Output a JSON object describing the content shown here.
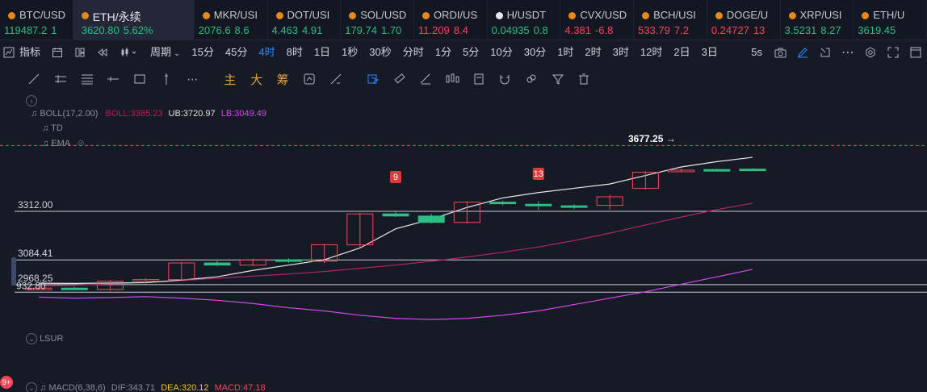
{
  "tickers": [
    {
      "symbol": "BTC/USD",
      "price": "119487.2",
      "change": "1",
      "dir": "up",
      "icon": "orange-dot-icon"
    },
    {
      "symbol": "ETH/永续",
      "price": "3620.80",
      "change": "5.62%",
      "dir": "up",
      "icon": "orange-dot-icon",
      "active": true
    },
    {
      "symbol": "MKR/USI",
      "price": "2076.6",
      "change": "8.6",
      "dir": "up",
      "icon": "orange-dot-icon"
    },
    {
      "symbol": "DOT/USI",
      "price": "4.463",
      "change": "4.91",
      "dir": "up",
      "icon": "orange-dot-icon"
    },
    {
      "symbol": "SOL/USD",
      "price": "179.74",
      "change": "1.70",
      "dir": "up",
      "icon": "orange-dot-icon"
    },
    {
      "symbol": "ORDI/US",
      "price": "11.209",
      "change": "8.4",
      "dir": "down",
      "icon": "orange-dot-icon"
    },
    {
      "symbol": "H/USDT",
      "price": "0.04935",
      "change": "0.8",
      "dir": "up",
      "icon": "white-dot-icon"
    },
    {
      "symbol": "CVX/USD",
      "price": "4.381",
      "change": "-6.8",
      "dir": "down",
      "icon": "orange-dot-icon"
    },
    {
      "symbol": "BCH/USI",
      "price": "533.79",
      "change": "7.2",
      "dir": "down",
      "icon": "orange-dot-icon"
    },
    {
      "symbol": "DOGE/U",
      "price": "0.24727",
      "change": "13",
      "dir": "down",
      "icon": "orange-dot-icon"
    },
    {
      "symbol": "XRP/USI",
      "price": "3.5231",
      "change": "8.27",
      "dir": "up",
      "icon": "orange-dot-icon"
    },
    {
      "symbol": "ETH/U",
      "price": "3619.45",
      "change": "",
      "dir": "up",
      "icon": "eth-icon"
    }
  ],
  "toolbar": {
    "indicators_label": "指标",
    "period_label": "周期",
    "intervals": [
      "15分",
      "45分",
      "4时",
      "8时",
      "1日",
      "1秒",
      "30秒",
      "分时",
      "1分",
      "5分",
      "10分",
      "30分",
      "1时",
      "2时",
      "3时",
      "12时",
      "2日",
      "3日"
    ],
    "selected_interval": "4时",
    "refresh_label": "5s"
  },
  "drawing_tools": {
    "main_label": "主",
    "big_label": "大",
    "chip_label": "筹"
  },
  "indicators": {
    "boll": {
      "label": "BOLL(17,2.00)",
      "mid": "BOLL:3385.23",
      "ub": "UB:3720.97",
      "lb": "LB:3049.49"
    },
    "td": "TD",
    "ema": "EMA",
    "lsur": "LSUR",
    "macd": {
      "label": "MACD(6,38,6)",
      "dif": "DIF:343.71",
      "dea": "DEA:320.12",
      "macd": "MACD:47.18"
    }
  },
  "price_labels": [
    "3312.00",
    "3084.41",
    "2968.25",
    "932.80"
  ],
  "annotations": {
    "high": "3677.25",
    "td_9": "9",
    "td_13": "13"
  },
  "notification_badge": "9+",
  "chart_data": {
    "type": "candlestick",
    "series": [
      {
        "name": "candles",
        "ohlc": [
          [
            2950,
            2955,
            2945,
            2952
          ],
          [
            2952,
            2958,
            2944,
            2946
          ],
          [
            2946,
            2990,
            2940,
            2985
          ],
          [
            2985,
            2998,
            2970,
            2992
          ],
          [
            2992,
            3075,
            2985,
            3070
          ],
          [
            3070,
            3080,
            3055,
            3060
          ],
          [
            3060,
            3090,
            3055,
            3085
          ],
          [
            3085,
            3092,
            3070,
            3078
          ],
          [
            3078,
            3160,
            3070,
            3155
          ],
          [
            3155,
            3305,
            3140,
            3300
          ],
          [
            3300,
            3310,
            3285,
            3290
          ],
          [
            3290,
            3300,
            3255,
            3260
          ],
          [
            3260,
            3360,
            3255,
            3355
          ],
          [
            3355,
            3362,
            3340,
            3348
          ],
          [
            3345,
            3360,
            3318,
            3338
          ],
          [
            3338,
            3345,
            3322,
            3332
          ],
          [
            3340,
            3390,
            3320,
            3380
          ],
          [
            3420,
            3500,
            3415,
            3495
          ],
          [
            3505,
            3512,
            3495,
            3505
          ],
          [
            3508,
            3512,
            3500,
            3506
          ],
          [
            3510,
            3514,
            3502,
            3506
          ]
        ]
      },
      {
        "name": "BOLL",
        "values": [
          2975,
          2974,
          2976,
          2978,
          2990,
          3005,
          3035,
          3060,
          3085,
          3140,
          3230,
          3275,
          3330,
          3375,
          3400,
          3420,
          3440,
          3480,
          3520,
          3545,
          3565
        ]
      },
      {
        "name": "UB",
        "values": [
          2962,
          2965,
          2972,
          2978,
          2988,
          2998,
          3008,
          3018,
          3030,
          3045,
          3060,
          3078,
          3098,
          3120,
          3145,
          3175,
          3210,
          3248,
          3285,
          3320,
          3350
        ]
      },
      {
        "name": "LB",
        "values": [
          2910,
          2905,
          2908,
          2912,
          2905,
          2895,
          2880,
          2860,
          2845,
          2825,
          2810,
          2805,
          2810,
          2825,
          2845,
          2875,
          2905,
          2935,
          2970,
          3005,
          3040
        ]
      }
    ],
    "horizontal_lines": [
      3312.0,
      3084.41,
      2968.25,
      2932.8
    ],
    "dashed_line": 3620.8
  }
}
